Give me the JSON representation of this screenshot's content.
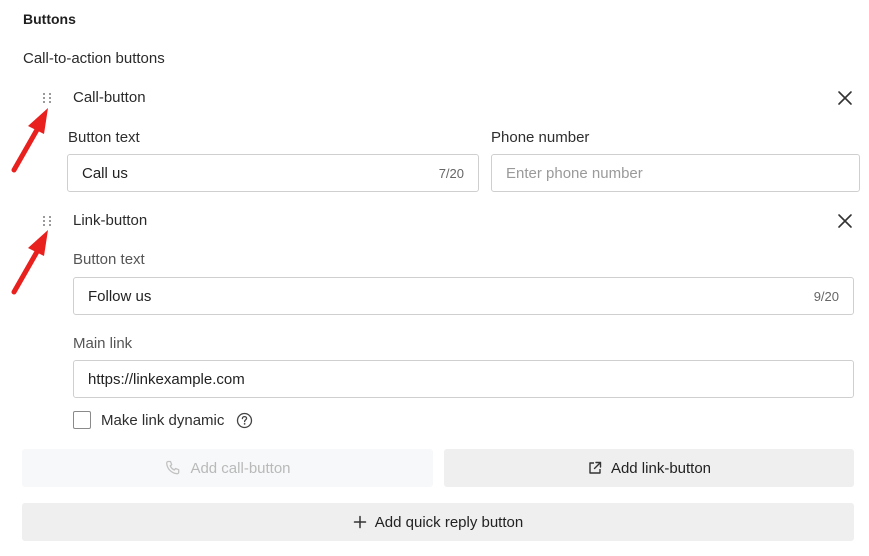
{
  "section": {
    "title": "Buttons",
    "subtitle": "Call-to-action buttons"
  },
  "call_button": {
    "title": "Call-button",
    "button_text_label": "Button text",
    "button_text_value": "Call us",
    "button_text_counter": "7/20",
    "phone_label": "Phone number",
    "phone_placeholder": "Enter phone number"
  },
  "link_button": {
    "title": "Link-button",
    "button_text_label": "Button text",
    "button_text_value": "Follow us",
    "button_text_counter": "9/20",
    "main_link_label": "Main link",
    "main_link_value": "https://linkexample.com",
    "dynamic_label": "Make link dynamic"
  },
  "actions": {
    "add_call": "Add call-button",
    "add_link": "Add link-button",
    "add_quick_reply": "Add quick reply button"
  },
  "icons": {
    "drag": "drag-handle-icon",
    "close": "close-icon",
    "help": "help-circle-icon",
    "phone": "phone-icon",
    "external_link": "external-link-icon",
    "plus": "plus-icon",
    "arrow": "red-arrow-annotation"
  },
  "colors": {
    "annotation_arrow": "#e8201e",
    "disabled_text": "#b9b9b9"
  }
}
